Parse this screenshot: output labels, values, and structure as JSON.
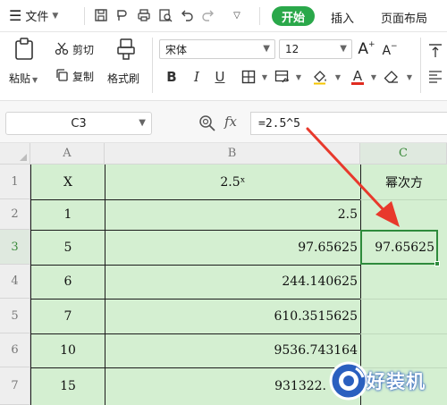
{
  "menu": {
    "file_label": "文件",
    "tabs": [
      {
        "label": "开始",
        "active": true
      },
      {
        "label": "插入",
        "active": false
      },
      {
        "label": "页面布局",
        "active": false
      }
    ]
  },
  "ribbon": {
    "paste_label": "粘贴",
    "cut_label": "剪切",
    "copy_label": "复制",
    "format_painter_label": "格式刷",
    "font_name": "宋体",
    "font_size": "12",
    "bold": "B",
    "italic": "I",
    "underline": "U",
    "font_color_glyph": "A",
    "grow_font": "A⁺",
    "shrink_font": "A⁻"
  },
  "formula_bar": {
    "cell_ref": "C3",
    "fx_label": "fx",
    "formula": "=2.5^5"
  },
  "sheet": {
    "columns": [
      "A",
      "B",
      "C"
    ],
    "active_column": "C",
    "active_row": "3",
    "rows": [
      {
        "row": "1",
        "a": "X",
        "b": "2.5ˣ",
        "c": "幂次方"
      },
      {
        "row": "2",
        "a": "1",
        "b": "2.5",
        "c": ""
      },
      {
        "row": "3",
        "a": "5",
        "b": "97.65625",
        "c": "97.65625"
      },
      {
        "row": "4",
        "a": "6",
        "b": "244.140625",
        "c": ""
      },
      {
        "row": "5",
        "a": "7",
        "b": "610.3515625",
        "c": ""
      },
      {
        "row": "6",
        "a": "10",
        "b": "9536.743164",
        "c": ""
      },
      {
        "row": "7",
        "a": "15",
        "b": "931322.",
        "c": ""
      }
    ]
  },
  "watermark": {
    "text": "好装机"
  },
  "colors": {
    "accent": "#2aa84a",
    "grid_fill": "#d4efd1",
    "arrow": "#e8392c",
    "selection": "#2e8b3c"
  }
}
